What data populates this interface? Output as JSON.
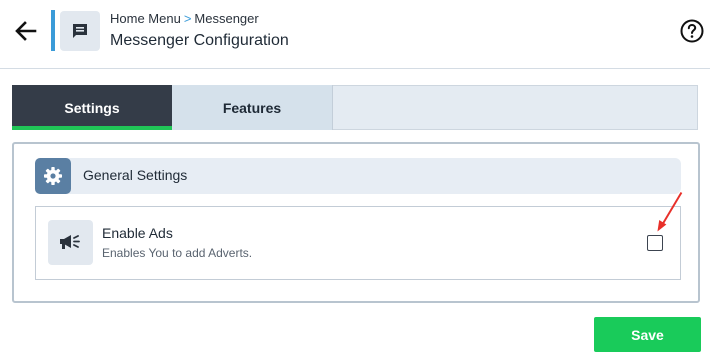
{
  "header": {
    "back_icon": "arrow-left-icon",
    "page_icon": "message-icon",
    "breadcrumb": {
      "parent": "Home Menu",
      "separator": ">",
      "current": "Messenger"
    },
    "title": "Messenger Configuration",
    "help_icon": "help-circle-icon"
  },
  "tabs": [
    {
      "label": "Settings",
      "active": true
    },
    {
      "label": "Features",
      "active": false
    }
  ],
  "section": {
    "icon": "gear-icon",
    "title": "General Settings",
    "settings": [
      {
        "icon": "megaphone-icon",
        "label": "Enable Ads",
        "description": "Enables You to add Adverts.",
        "checked": false
      }
    ]
  },
  "footer": {
    "save_label": "Save"
  },
  "colors": {
    "accent_blue": "#3a9bd8",
    "tab_active_bg": "#343c48",
    "tab_active_underline": "#20c657",
    "save_green": "#19cb5a",
    "gear_tile": "#5a7fa3",
    "annotation_arrow": "#e8302a"
  }
}
